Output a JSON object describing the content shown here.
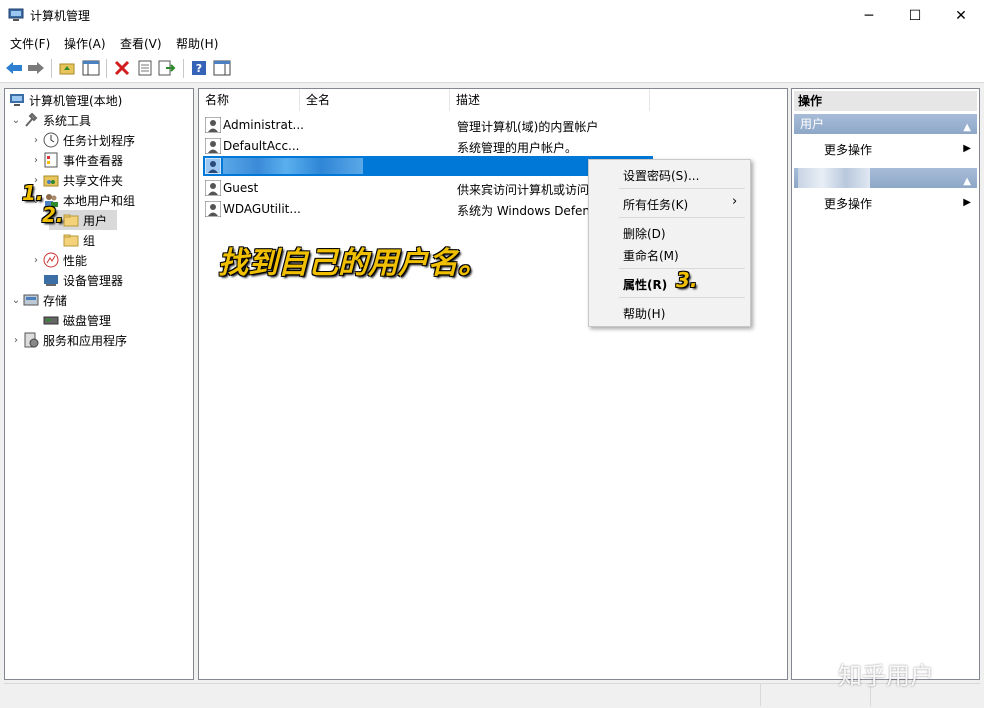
{
  "window": {
    "title": "计算机管理",
    "minimize": "─",
    "maximize": "☐",
    "close": "✕"
  },
  "menu": [
    "文件(F)",
    "操作(A)",
    "查看(V)",
    "帮助(H)"
  ],
  "tree": {
    "root": "计算机管理(本地)",
    "system_tools": "系统工具",
    "task_scheduler": "任务计划程序",
    "event_viewer": "事件查看器",
    "shared_folders": "共享文件夹",
    "local_users_groups": "本地用户和组",
    "users": "用户",
    "groups": "组",
    "performance": "性能",
    "device_manager": "设备管理器",
    "storage": "存储",
    "disk_management": "磁盘管理",
    "services_apps": "服务和应用程序"
  },
  "list": {
    "columns": [
      "名称",
      "全名",
      "描述"
    ],
    "rows": [
      {
        "name": "Administrat...",
        "desc": "管理计算机(域)的内置帐户"
      },
      {
        "name": "DefaultAcc...",
        "desc": "系统管理的用户帐户。"
      },
      {
        "name": "",
        "desc": ""
      },
      {
        "name": "Guest",
        "desc": "供来宾访问计算机或访问"
      },
      {
        "name": "WDAGUtilit...",
        "desc": "系统为 Windows Defen"
      }
    ]
  },
  "context_menu": {
    "set_password": "设置密码(S)...",
    "all_tasks": "所有任务(K)",
    "delete": "删除(D)",
    "rename": "重命名(M)",
    "properties": "属性(R)",
    "help": "帮助(H)"
  },
  "actions": {
    "header": "操作",
    "section1": "用户",
    "more1": "更多操作",
    "section2": "",
    "more2": "更多操作"
  },
  "annotations": {
    "step1": "1.",
    "step2": "2.",
    "step3": "3.",
    "caption": "找到自己的用户名。"
  },
  "watermark": "知乎用户",
  "colors": {
    "selection": "#0078d7",
    "accent": "#f0c000"
  }
}
